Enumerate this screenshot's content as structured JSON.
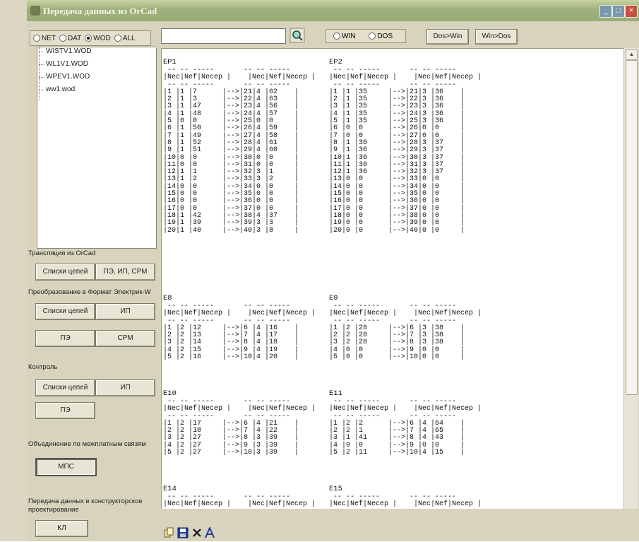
{
  "window": {
    "title": "Передача данных из OrCad"
  },
  "radio_source": [
    {
      "label": "NET",
      "checked": false
    },
    {
      "label": "DAT",
      "checked": false
    },
    {
      "label": "WOD",
      "checked": true
    },
    {
      "label": "ALL",
      "checked": false
    }
  ],
  "files": [
    "WISTV1.WOD",
    "WL1V1.WOD",
    "WPEV1.WOD",
    "ww1.wod"
  ],
  "sections": {
    "translation": "Трансляция из OrCad",
    "conversion": "Преобразование в Формат Электрик-W",
    "control": "Контроль",
    "union": "Объединение по межплатным связям",
    "transfer": "Передача данных в конструкторское проектирование"
  },
  "buttons": {
    "t_lists": "Списки цепей",
    "t_pe": "ПЭ, ИП, СРМ",
    "c_lists": "Списки цепей",
    "c_ip": "ИП",
    "c_pe": "ПЭ",
    "c_srm": "СРМ",
    "k_lists": "Списки цепей",
    "k_ip": "ИП",
    "k_pe": "ПЭ",
    "mps": "МПС",
    "kl": "КЛ"
  },
  "search": {
    "value": ""
  },
  "encoding": [
    {
      "label": "WIN",
      "checked": false
    },
    {
      "label": "DOS",
      "checked": false
    }
  ],
  "convert": {
    "dos_win": "Dos>Win",
    "win_dos": "Win>Dos"
  },
  "colors": {
    "titlebar": "#9eb07b",
    "panel": "#d8d3bc"
  },
  "report": {
    "left": [
      {
        "title": "EP1",
        "body": " -- -- -----       -- -- -----\n|Nec|Nef|Necep |    |Nec|Nef|Necep |\n -- -- -----       -- -- -----\n|1 |1 |7      |-->|21|4 |62    |\n|2 |1 |3      |-->|22|4 |63    |\n|3 |1 |47     |-->|23|4 |56    |\n|4 |1 |48     |-->|24|4 |57    |\n|5 |0 |0      |-->|25|0 |0     |\n|6 |1 |50     |-->|26|4 |59    |\n|7 |1 |49     |-->|27|4 |58    |\n|8 |1 |52     |-->|28|4 |61    |\n|9 |1 |51     |-->|29|4 |60    |\n|10|0 |0      |-->|30|0 |0     |\n|11|0 |0      |-->|31|0 |0     |\n|12|1 |1      |-->|32|3 |1     |\n|13|1 |2      |-->|33|3 |2     |\n|14|0 |0      |-->|34|0 |0     |\n|15|0 |0      |-->|35|0 |0     |\n|16|0 |0      |-->|36|0 |0     |\n|17|0 |0      |-->|37|0 |0     |\n|18|1 |42     |-->|38|4 |37    |\n|19|1 |39     |-->|39|3 |3     |\n|20|1 |40     |-->|40|3 |8     |"
      },
      {
        "title": "E8",
        "body": " -- -- -----       -- -- -----\n|Nec|Nef|Necep |    |Nec|Nef|Necep |\n -- -- -----       -- -- -----\n|1 |2 |12     |-->|6 |4 |16    |\n|2 |2 |13     |-->|7 |4 |17    |\n|3 |2 |14     |-->|8 |4 |18    |\n|4 |2 |15     |-->|9 |4 |19    |\n|5 |2 |16     |-->|10|4 |20    |"
      },
      {
        "title": "E10",
        "body": " -- -- -----       -- -- -----\n|Nec|Nef|Necep |    |Nec|Nef|Necep |\n -- -- -----       -- -- -----\n|1 |2 |17     |-->|6 |4 |21    |\n|2 |2 |18     |-->|7 |4 |22    |\n|3 |2 |27     |-->|8 |3 |39    |\n|4 |2 |27     |-->|9 |3 |39    |\n|5 |2 |27     |-->|10|3 |39    |"
      },
      {
        "title": "E14",
        "body": " -- -- -----       -- -- -----\n|Nec|Nef|Necep |    |Nec|Nef|Necep |"
      }
    ],
    "right": [
      {
        "title": "EP2",
        "body": " -- -- -----       -- -- -----\n|Nec|Nef|Necep |    |Nec|Nef|Necep |\n -- -- -----       -- -- -----\n|1 |1 |35     |-->|21|3 |36    |\n|2 |1 |35     |-->|22|3 |36    |\n|3 |1 |35     |-->|23|3 |36    |\n|4 |1 |35     |-->|24|3 |36    |\n|5 |1 |35     |-->|25|3 |36    |\n|6 |0 |0      |-->|26|0 |0     |\n|7 |0 |0      |-->|27|0 |0     |\n|8 |1 |36     |-->|28|3 |37    |\n|9 |1 |36     |-->|29|3 |37    |\n|10|1 |36     |-->|30|3 |37    |\n|11|1 |36     |-->|31|3 |37    |\n|12|1 |36     |-->|32|3 |37    |\n|13|0 |0      |-->|33|0 |0     |\n|14|0 |0      |-->|34|0 |0     |\n|15|0 |0      |-->|35|0 |0     |\n|16|0 |0      |-->|36|0 |0     |\n|17|0 |0      |-->|37|0 |0     |\n|18|0 |0      |-->|38|0 |0     |\n|19|0 |0      |-->|39|0 |0     |\n|20|0 |0      |-->|40|0 |0     |"
      },
      {
        "title": "E9",
        "body": " -- -- -----       -- -- -----\n|Nec|Nef|Necep |    |Nec|Nef|Necep |\n -- -- -----       -- -- -----\n|1 |2 |28     |-->|6 |3 |38    |\n|2 |2 |28     |-->|7 |3 |38    |\n|3 |2 |28     |-->|8 |3 |38    |\n|4 |0 |0      |-->|9 |0 |0     |\n|5 |0 |0      |-->|10|0 |0     |"
      },
      {
        "title": "E11",
        "body": " -- -- -----       -- -- -----\n|Nec|Nef|Necep |    |Nec|Nef|Necep |\n -- -- -----       -- -- -----\n|1 |2 |2      |-->|6 |4 |64    |\n|2 |2 |1      |-->|7 |4 |65    |\n|3 |1 |41     |-->|8 |4 |43    |\n|4 |0 |0      |-->|9 |0 |0     |\n|5 |2 |11     |-->|10|4 |15    |"
      },
      {
        "title": "E15",
        "body": " -- -- -----       -- -- -----\n|Nec|Nef|Necep |    |Nec|Nef|Necep |"
      }
    ]
  },
  "toolbar_icons": [
    "copy-icon",
    "save-icon",
    "close-icon",
    "font-icon"
  ]
}
